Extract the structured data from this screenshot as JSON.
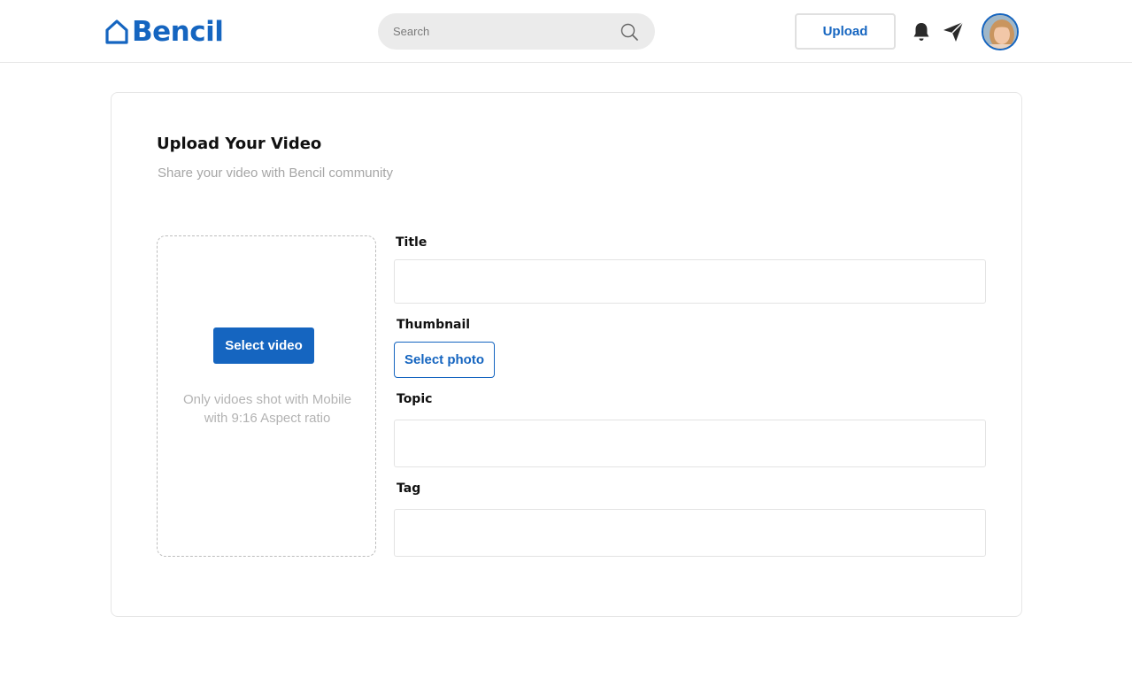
{
  "header": {
    "logo_text": "Bencil",
    "search_placeholder": "Search",
    "upload_label": "Upload",
    "icons": [
      "home-icon",
      "search-icon",
      "bell-icon",
      "send-icon",
      "avatar"
    ]
  },
  "card": {
    "title": "Upload Your Video",
    "subtitle": "Share your video with Bencil community",
    "dropzone": {
      "button_label": "Select video",
      "note_line1": "Only vidoes shot with Mobile",
      "note_line2": "with 9:16 Aspect ratio"
    },
    "fields": {
      "title_label": "Title",
      "title_value": "",
      "thumbnail_label": "Thumbnail",
      "thumbnail_button": "Select photo",
      "topic_label": "Topic",
      "topic_value": "",
      "tag_label": "Tag",
      "tag_value": ""
    }
  },
  "colors": {
    "brand": "#1565c0",
    "muted_text": "#a6a6a6",
    "border": "#e3e3e3"
  }
}
